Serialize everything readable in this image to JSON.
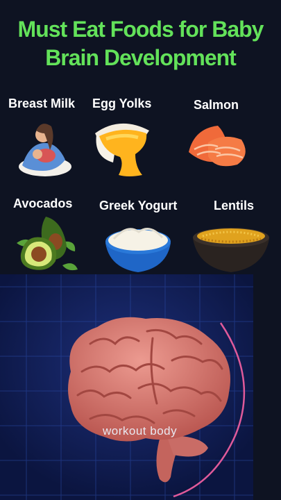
{
  "title": "Must Eat Foods for Baby Brain Development",
  "foods": [
    {
      "label": "Breast Milk",
      "icon": "breastfeeding-icon"
    },
    {
      "label": "Egg Yolks",
      "icon": "egg-yolk-icon"
    },
    {
      "label": "Salmon",
      "icon": "salmon-icon"
    },
    {
      "label": "Avocados",
      "icon": "avocado-icon"
    },
    {
      "label": "Greek Yogurt",
      "icon": "yogurt-icon"
    },
    {
      "label": "Lentils",
      "icon": "lentils-icon"
    }
  ],
  "brain": {
    "caption": "workout body"
  },
  "colors": {
    "title": "#63e25a",
    "background": "#0e1322",
    "panel": "#0b1540",
    "brain": "#d9776e",
    "ring": "#e05a9a"
  }
}
